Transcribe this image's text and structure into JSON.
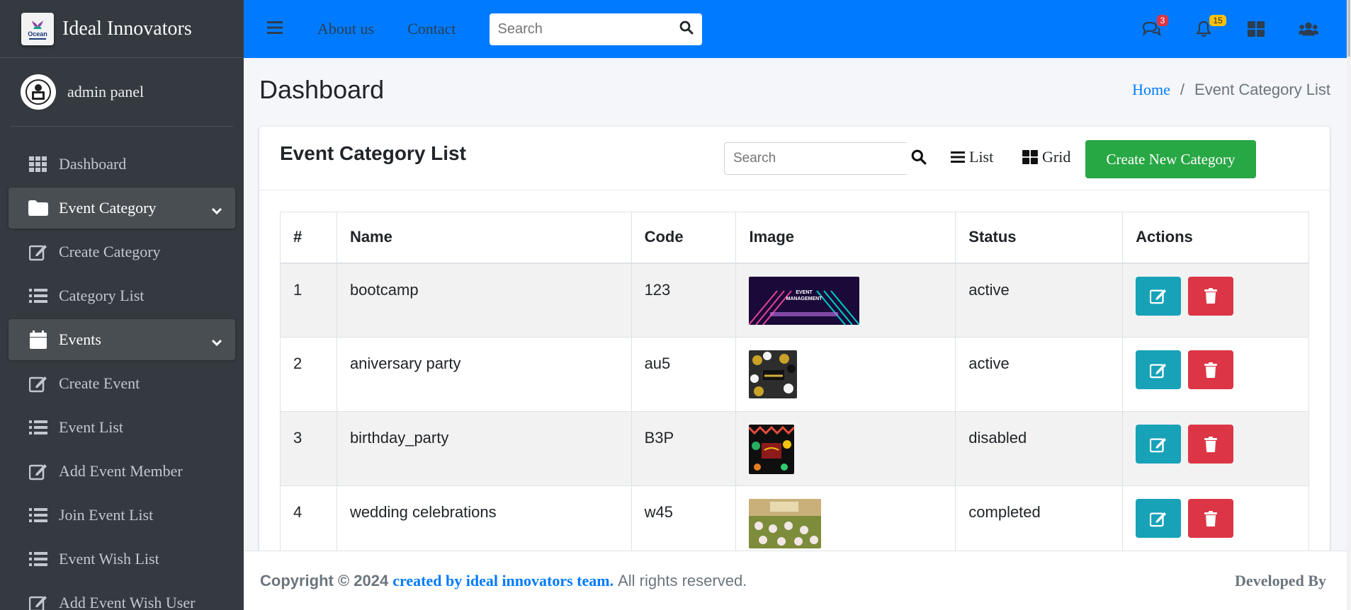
{
  "brand": {
    "logo_text": "Ocean",
    "name": "Ideal Innovators"
  },
  "user": {
    "name": "admin panel"
  },
  "sidebar": {
    "items": [
      {
        "label": "Dashboard",
        "icon": "grid-icon"
      },
      {
        "label": "Event Category",
        "icon": "folder-icon",
        "open": true
      },
      {
        "label": "Create Category",
        "icon": "edit-icon"
      },
      {
        "label": "Category List",
        "icon": "list-icon"
      },
      {
        "label": "Events",
        "icon": "calendar-icon",
        "open": true
      },
      {
        "label": "Create Event",
        "icon": "edit-icon"
      },
      {
        "label": "Event List",
        "icon": "list-icon"
      },
      {
        "label": "Add Event Member",
        "icon": "edit-icon"
      },
      {
        "label": "Join Event List",
        "icon": "list-icon"
      },
      {
        "label": "Event Wish List",
        "icon": "list-icon"
      },
      {
        "label": "Add Event Wish User",
        "icon": "edit-icon"
      }
    ]
  },
  "topbar": {
    "links": [
      "About us",
      "Contact"
    ],
    "search_placeholder": "Search",
    "messages_count": "3",
    "notifications_count": "15"
  },
  "page": {
    "title": "Dashboard",
    "breadcrumb_home": "Home",
    "breadcrumb_sep": "/",
    "breadcrumb_current": "Event Category List"
  },
  "card": {
    "title": "Event Category List",
    "search_placeholder": "Search",
    "list_label": "List",
    "grid_label": "Grid",
    "create_label": "Create New Category"
  },
  "table": {
    "headers": [
      "#",
      "Name",
      "Code",
      "Image",
      "Status",
      "Actions"
    ],
    "rows": [
      {
        "num": "1",
        "name": "bootcamp",
        "code": "123",
        "status": "active"
      },
      {
        "num": "2",
        "name": "aniversary party",
        "code": "au5",
        "status": "active"
      },
      {
        "num": "3",
        "name": "birthday_party",
        "code": "B3P",
        "status": "disabled"
      },
      {
        "num": "4",
        "name": "wedding celebrations",
        "code": "w45",
        "status": "completed"
      }
    ],
    "thumb1_title": "EVENT",
    "thumb1_sub": "MANAGEMENT"
  },
  "footer": {
    "copyright": "Copyright © 2024",
    "team": "created by ideal innovators team.",
    "rights": "All rights reserved.",
    "developed": "Developed By"
  },
  "colors": {
    "primary": "#007bff",
    "success": "#28a745",
    "info": "#17a2b8",
    "danger": "#dc3545",
    "sidebar": "#343a40"
  }
}
